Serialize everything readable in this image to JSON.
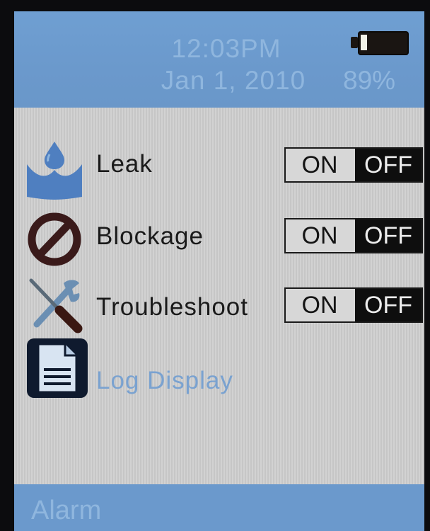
{
  "status": {
    "time": "12:03PM",
    "date": "Jan 1, 2010",
    "battery_percent": "89%",
    "battery_level": 0.15
  },
  "menu": [
    {
      "label": "Leak",
      "icon": "water-drop-icon",
      "toggle_on": "ON",
      "toggle_off": "OFF",
      "state": "OFF"
    },
    {
      "label": "Blockage",
      "icon": "prohibited-icon",
      "toggle_on": "ON",
      "toggle_off": "OFF",
      "state": "OFF"
    },
    {
      "label": "Troubleshoot",
      "icon": "tools-icon",
      "toggle_on": "ON",
      "toggle_off": "OFF",
      "state": "OFF"
    },
    {
      "label": "Log Display",
      "icon": "document-icon"
    }
  ],
  "footer": {
    "label": "Alarm"
  },
  "colors": {
    "header_blue": "#6b99cc",
    "header_text": "#8fb6de",
    "off_active": "#0e0e0e",
    "log_text": "#7aa2d0"
  }
}
